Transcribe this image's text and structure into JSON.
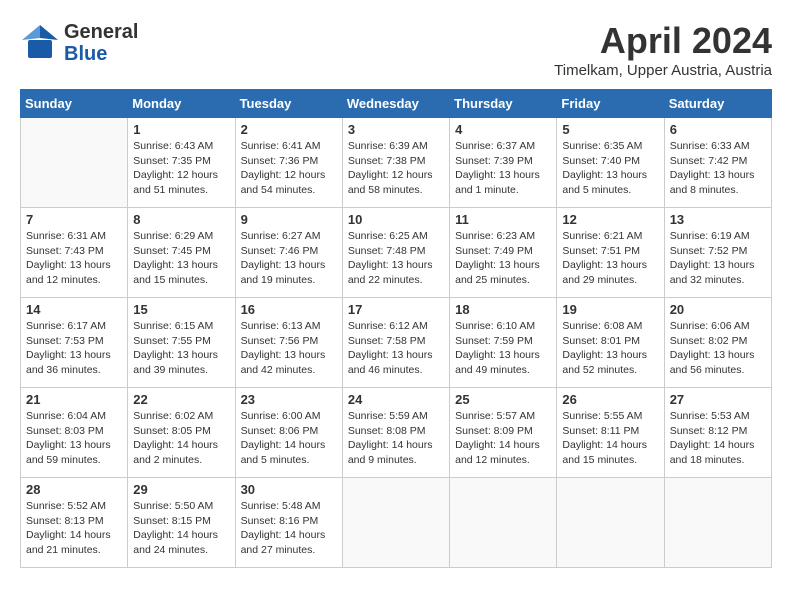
{
  "header": {
    "logo_general": "General",
    "logo_blue": "Blue",
    "month": "April 2024",
    "location": "Timelkam, Upper Austria, Austria"
  },
  "weekdays": [
    "Sunday",
    "Monday",
    "Tuesday",
    "Wednesday",
    "Thursday",
    "Friday",
    "Saturday"
  ],
  "weeks": [
    [
      {
        "day": "",
        "info": ""
      },
      {
        "day": "1",
        "info": "Sunrise: 6:43 AM\nSunset: 7:35 PM\nDaylight: 12 hours\nand 51 minutes."
      },
      {
        "day": "2",
        "info": "Sunrise: 6:41 AM\nSunset: 7:36 PM\nDaylight: 12 hours\nand 54 minutes."
      },
      {
        "day": "3",
        "info": "Sunrise: 6:39 AM\nSunset: 7:38 PM\nDaylight: 12 hours\nand 58 minutes."
      },
      {
        "day": "4",
        "info": "Sunrise: 6:37 AM\nSunset: 7:39 PM\nDaylight: 13 hours\nand 1 minute."
      },
      {
        "day": "5",
        "info": "Sunrise: 6:35 AM\nSunset: 7:40 PM\nDaylight: 13 hours\nand 5 minutes."
      },
      {
        "day": "6",
        "info": "Sunrise: 6:33 AM\nSunset: 7:42 PM\nDaylight: 13 hours\nand 8 minutes."
      }
    ],
    [
      {
        "day": "7",
        "info": "Sunrise: 6:31 AM\nSunset: 7:43 PM\nDaylight: 13 hours\nand 12 minutes."
      },
      {
        "day": "8",
        "info": "Sunrise: 6:29 AM\nSunset: 7:45 PM\nDaylight: 13 hours\nand 15 minutes."
      },
      {
        "day": "9",
        "info": "Sunrise: 6:27 AM\nSunset: 7:46 PM\nDaylight: 13 hours\nand 19 minutes."
      },
      {
        "day": "10",
        "info": "Sunrise: 6:25 AM\nSunset: 7:48 PM\nDaylight: 13 hours\nand 22 minutes."
      },
      {
        "day": "11",
        "info": "Sunrise: 6:23 AM\nSunset: 7:49 PM\nDaylight: 13 hours\nand 25 minutes."
      },
      {
        "day": "12",
        "info": "Sunrise: 6:21 AM\nSunset: 7:51 PM\nDaylight: 13 hours\nand 29 minutes."
      },
      {
        "day": "13",
        "info": "Sunrise: 6:19 AM\nSunset: 7:52 PM\nDaylight: 13 hours\nand 32 minutes."
      }
    ],
    [
      {
        "day": "14",
        "info": "Sunrise: 6:17 AM\nSunset: 7:53 PM\nDaylight: 13 hours\nand 36 minutes."
      },
      {
        "day": "15",
        "info": "Sunrise: 6:15 AM\nSunset: 7:55 PM\nDaylight: 13 hours\nand 39 minutes."
      },
      {
        "day": "16",
        "info": "Sunrise: 6:13 AM\nSunset: 7:56 PM\nDaylight: 13 hours\nand 42 minutes."
      },
      {
        "day": "17",
        "info": "Sunrise: 6:12 AM\nSunset: 7:58 PM\nDaylight: 13 hours\nand 46 minutes."
      },
      {
        "day": "18",
        "info": "Sunrise: 6:10 AM\nSunset: 7:59 PM\nDaylight: 13 hours\nand 49 minutes."
      },
      {
        "day": "19",
        "info": "Sunrise: 6:08 AM\nSunset: 8:01 PM\nDaylight: 13 hours\nand 52 minutes."
      },
      {
        "day": "20",
        "info": "Sunrise: 6:06 AM\nSunset: 8:02 PM\nDaylight: 13 hours\nand 56 minutes."
      }
    ],
    [
      {
        "day": "21",
        "info": "Sunrise: 6:04 AM\nSunset: 8:03 PM\nDaylight: 13 hours\nand 59 minutes."
      },
      {
        "day": "22",
        "info": "Sunrise: 6:02 AM\nSunset: 8:05 PM\nDaylight: 14 hours\nand 2 minutes."
      },
      {
        "day": "23",
        "info": "Sunrise: 6:00 AM\nSunset: 8:06 PM\nDaylight: 14 hours\nand 5 minutes."
      },
      {
        "day": "24",
        "info": "Sunrise: 5:59 AM\nSunset: 8:08 PM\nDaylight: 14 hours\nand 9 minutes."
      },
      {
        "day": "25",
        "info": "Sunrise: 5:57 AM\nSunset: 8:09 PM\nDaylight: 14 hours\nand 12 minutes."
      },
      {
        "day": "26",
        "info": "Sunrise: 5:55 AM\nSunset: 8:11 PM\nDaylight: 14 hours\nand 15 minutes."
      },
      {
        "day": "27",
        "info": "Sunrise: 5:53 AM\nSunset: 8:12 PM\nDaylight: 14 hours\nand 18 minutes."
      }
    ],
    [
      {
        "day": "28",
        "info": "Sunrise: 5:52 AM\nSunset: 8:13 PM\nDaylight: 14 hours\nand 21 minutes."
      },
      {
        "day": "29",
        "info": "Sunrise: 5:50 AM\nSunset: 8:15 PM\nDaylight: 14 hours\nand 24 minutes."
      },
      {
        "day": "30",
        "info": "Sunrise: 5:48 AM\nSunset: 8:16 PM\nDaylight: 14 hours\nand 27 minutes."
      },
      {
        "day": "",
        "info": ""
      },
      {
        "day": "",
        "info": ""
      },
      {
        "day": "",
        "info": ""
      },
      {
        "day": "",
        "info": ""
      }
    ]
  ]
}
